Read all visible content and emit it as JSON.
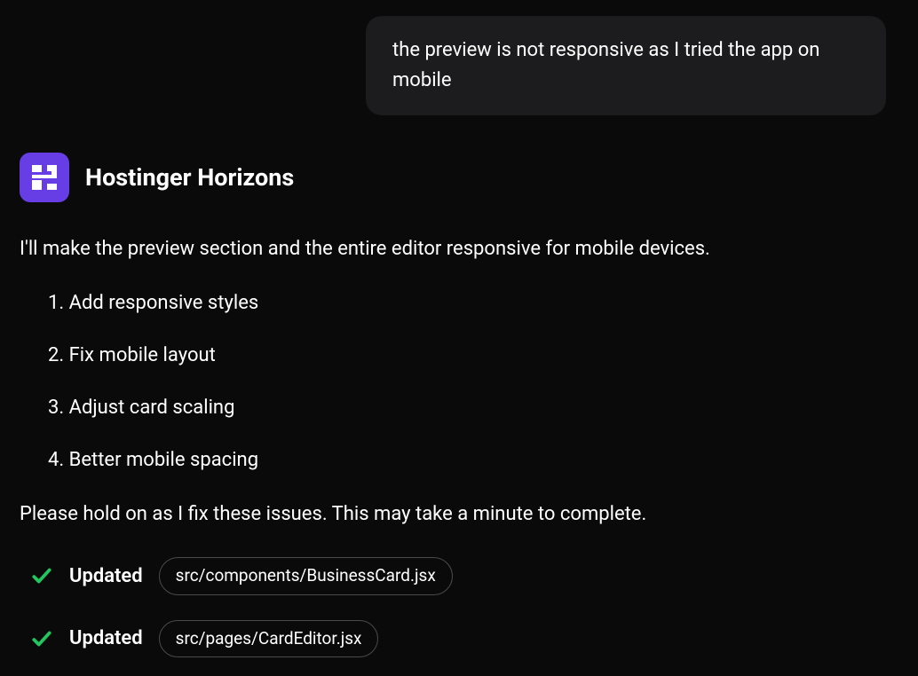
{
  "user_message": "the preview is not responsive as I tried the app on mobile",
  "assistant": {
    "name": "Hostinger Horizons",
    "intro": "I'll make the preview section and the entire editor responsive for mobile devices.",
    "tasks": [
      "Add responsive styles",
      "Fix mobile layout",
      "Adjust card scaling",
      "Better mobile spacing"
    ],
    "wait_text": "Please hold on as I fix these issues. This may take a minute to complete.",
    "updates": [
      {
        "status": "Updated",
        "file": "src/components/BusinessCard.jsx"
      },
      {
        "status": "Updated",
        "file": "src/pages/CardEditor.jsx"
      }
    ]
  }
}
